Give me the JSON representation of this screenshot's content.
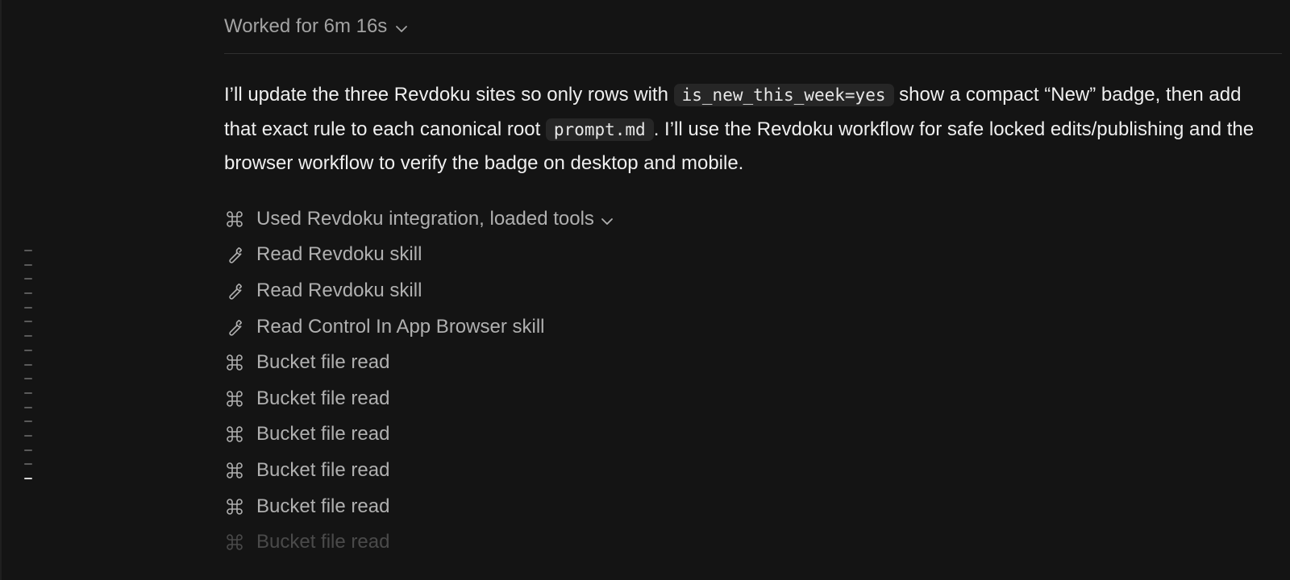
{
  "header": {
    "worked_label": "Worked for 6m 16s",
    "chevron_icon": "chevron-down-icon"
  },
  "message": {
    "part1": "I’ll update the three Revdoku sites so only rows with ",
    "code1": "is_new_this_week=yes",
    "part2": " show a compact “New” badge, then add that exact rule to each canonical root ",
    "code2": "prompt.md",
    "part3": ". I’ll use the Revdoku workflow for safe locked edits/publishing and the browser workflow to verify the badge on desktop and mobile."
  },
  "tools": [
    {
      "icon": "command-icon",
      "label": "Used Revdoku integration, loaded tools"
    },
    {
      "icon": "wrench-icon",
      "label": "Read Revdoku skill"
    },
    {
      "icon": "wrench-icon",
      "label": "Read Revdoku skill"
    },
    {
      "icon": "wrench-icon",
      "label": "Read Control In App Browser skill"
    },
    {
      "icon": "command-icon",
      "label": "Bucket file read"
    },
    {
      "icon": "command-icon",
      "label": "Bucket file read"
    },
    {
      "icon": "command-icon",
      "label": "Bucket file read"
    },
    {
      "icon": "command-icon",
      "label": "Bucket file read"
    },
    {
      "icon": "command-icon",
      "label": "Bucket file read"
    },
    {
      "icon": "command-icon",
      "label": "Bucket file read"
    }
  ],
  "colors": {
    "background": "#141414",
    "text": "#efefef",
    "muted": "#b0b0b0",
    "code_bg": "#262626"
  }
}
